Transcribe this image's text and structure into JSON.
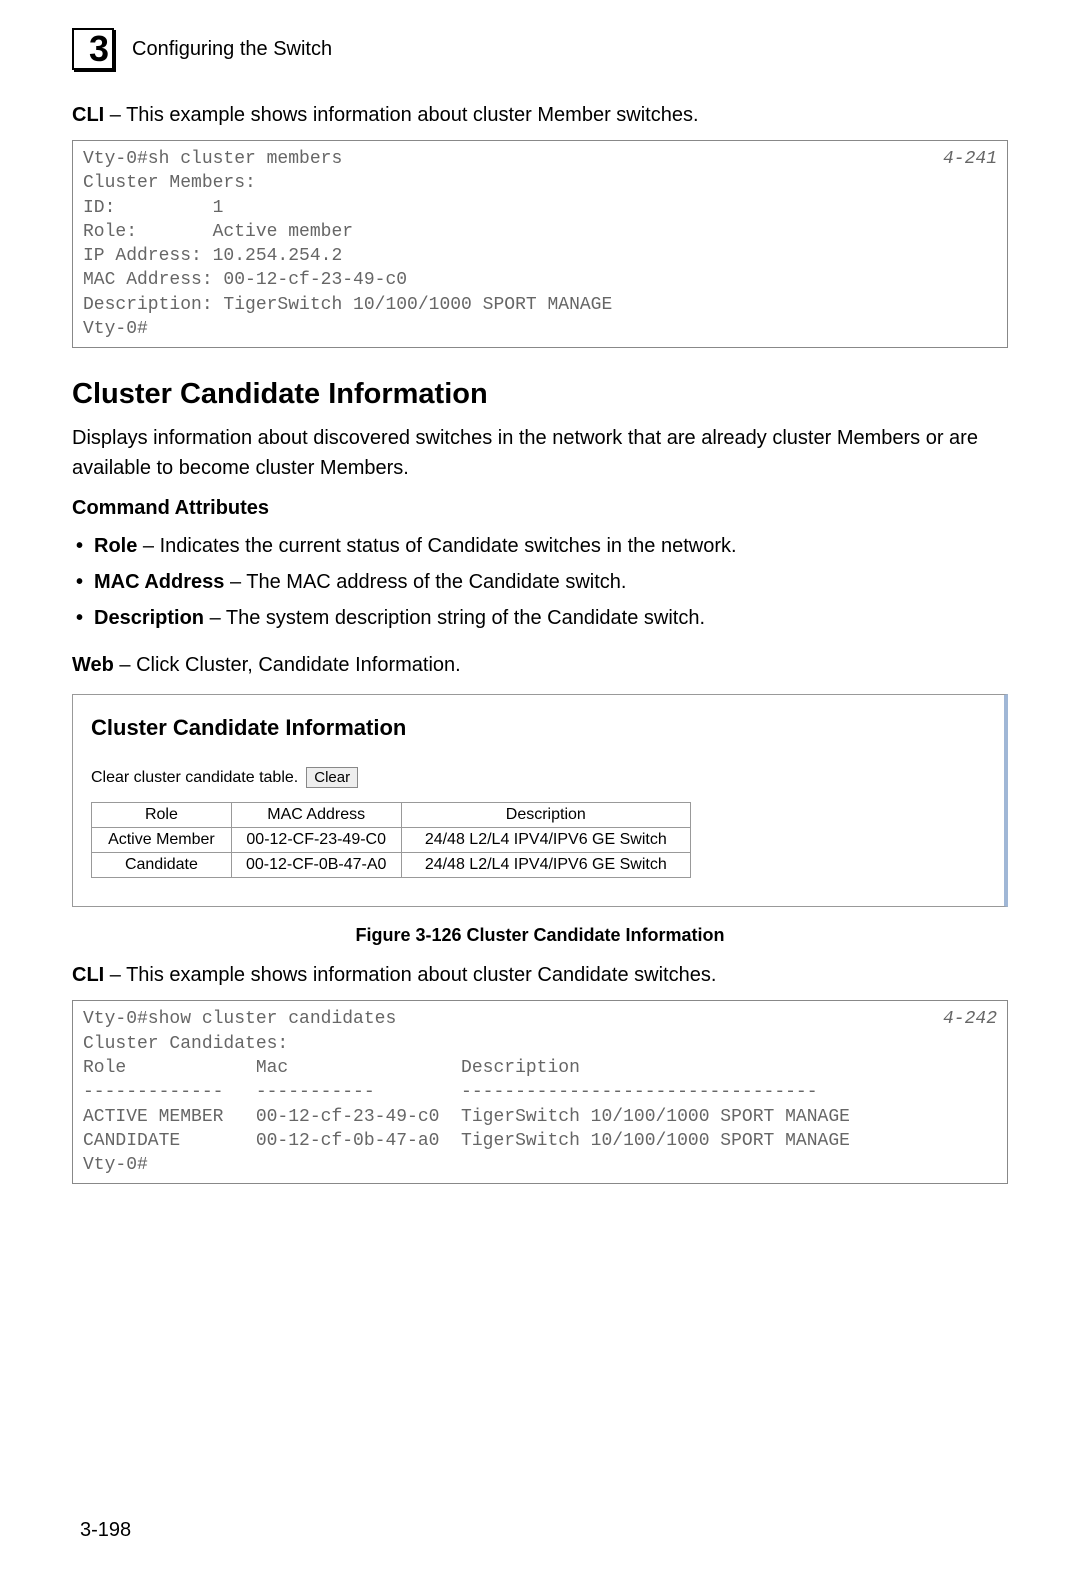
{
  "header": {
    "chapter_number": "3",
    "chapter_title": "Configuring the Switch"
  },
  "cli1": {
    "intro_bold": "CLI",
    "intro_rest": " – This example shows information about cluster Member switches.",
    "page_ref": "4-241",
    "text": "Vty-0#sh cluster members\nCluster Members:\nID:         1\nRole:       Active member\nIP Address: 10.254.254.2\nMAC Address: 00-12-cf-23-49-c0\nDescription: TigerSwitch 10/100/1000 SPORT MANAGE\nVty-0#"
  },
  "section": {
    "heading": "Cluster Candidate Information",
    "description": "Displays information about discovered switches in the network that are already cluster Members or are available to become cluster Members.",
    "attr_heading": "Command Attributes",
    "attributes": [
      {
        "term": "Role",
        "def": " – Indicates the current status of Candidate switches in the network."
      },
      {
        "term": "MAC Address",
        "def": " – The MAC address of the Candidate switch."
      },
      {
        "term": "Description",
        "def": " – The system description string of the Candidate switch."
      }
    ],
    "web_bold": "Web",
    "web_rest": " – Click Cluster, Candidate Information."
  },
  "web_ui": {
    "title": "Cluster Candidate Information",
    "clear_label": "Clear cluster candidate table.",
    "clear_button": "Clear",
    "columns": {
      "role": "Role",
      "mac": "MAC Address",
      "desc": "Description"
    },
    "rows": [
      {
        "role": "Active Member",
        "mac": "00-12-CF-23-49-C0",
        "desc": "24/48 L2/L4 IPV4/IPV6 GE Switch"
      },
      {
        "role": "Candidate",
        "mac": "00-12-CF-0B-47-A0",
        "desc": "24/48 L2/L4 IPV4/IPV6 GE Switch"
      }
    ]
  },
  "figure_caption": "Figure 3-126  Cluster Candidate Information",
  "cli2": {
    "intro_bold": "CLI",
    "intro_rest": " – This example shows information about cluster Candidate switches.",
    "page_ref": "4-242",
    "text": "Vty-0#show cluster candidates\nCluster Candidates:\nRole            Mac                Description\n-------------   -----------        ---------------------------------\nACTIVE MEMBER   00-12-cf-23-49-c0  TigerSwitch 10/100/1000 SPORT MANAGE\nCANDIDATE       00-12-cf-0b-47-a0  TigerSwitch 10/100/1000 SPORT MANAGE\nVty-0#"
  },
  "page_number": "3-198"
}
